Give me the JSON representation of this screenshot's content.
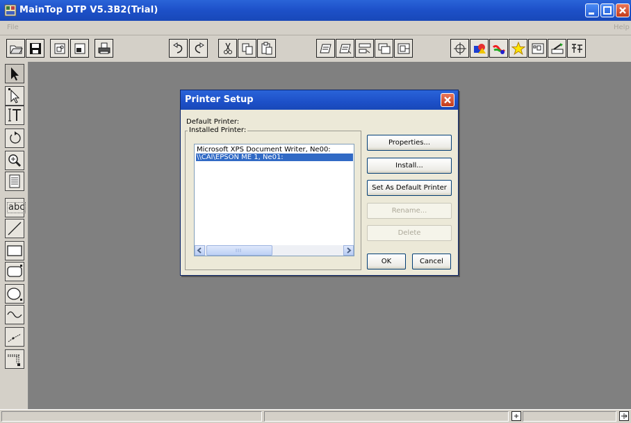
{
  "window": {
    "title": "MainTop DTP V5.3B2(Trial)"
  },
  "menu": {
    "file": "File",
    "help": "Help"
  },
  "palette": {
    "text_tool_label": "abc"
  },
  "dialog": {
    "title": "Printer Setup",
    "default_printer_label": "Default Printer:",
    "installed_printer_label": "Installed Printer:",
    "printers": [
      "Microsoft XPS Document Writer, Ne00:",
      "\\\\CAI\\EPSON ME 1, Ne01:"
    ],
    "selected_index": 1,
    "buttons": {
      "properties": "Properties...",
      "install": "Install...",
      "set_default": "Set As Default Printer",
      "rename": "Rename...",
      "delete": "Delete",
      "ok": "OK",
      "cancel": "Cancel"
    }
  },
  "colors": {
    "titlebar": "#1d50c8",
    "selection": "#316ac5",
    "workspace": "#808080",
    "close": "#c33b1a"
  }
}
